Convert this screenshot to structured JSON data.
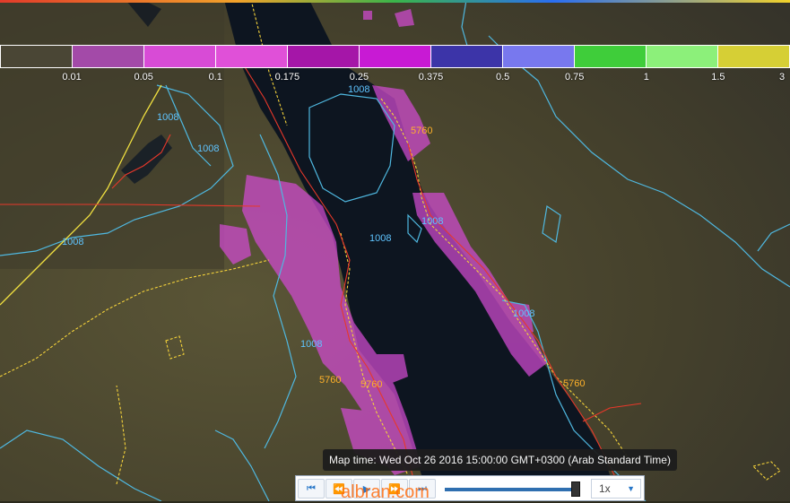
{
  "legend": {
    "ticks": [
      "0.01",
      "0.05",
      "0.1",
      "0.175",
      "0.25",
      "0.375",
      "0.5",
      "0.75",
      "1",
      "1.5",
      "3"
    ],
    "colors": [
      "#4a4635",
      "#a34aa8",
      "#d84bd6",
      "#e050d8",
      "#a516a8",
      "#c81ad4",
      "#3c34a8",
      "#7878ee",
      "#3fcd3a",
      "#8cf07a",
      "#d6cf35",
      "#f7ef55"
    ]
  },
  "contour_labels": {
    "blue": [
      "1008",
      "1008",
      "1008",
      "1008",
      "1008",
      "1008",
      "1008",
      "1008"
    ],
    "orange": [
      "5760",
      "5760",
      "5760",
      "5760"
    ]
  },
  "colors": {
    "precip": "#d24bd2",
    "isobar": "#4fb8e0",
    "height_contour": "#f5d33a",
    "border": "#e8382a",
    "sea": "#0d1520",
    "land": "#4a4630"
  },
  "map_time": "Map time: Wed Oct 26 2016 15:00:00 GMT+0300 (Arab Standard Time)",
  "playback": {
    "first_icon": "skip-first-icon",
    "prev_icon": "step-back-icon",
    "play_icon": "play-icon",
    "next_icon": "step-forward-icon",
    "last_icon": "skip-last-icon",
    "progress": 0.97,
    "speed": "1x"
  },
  "watermark": "albran.com"
}
